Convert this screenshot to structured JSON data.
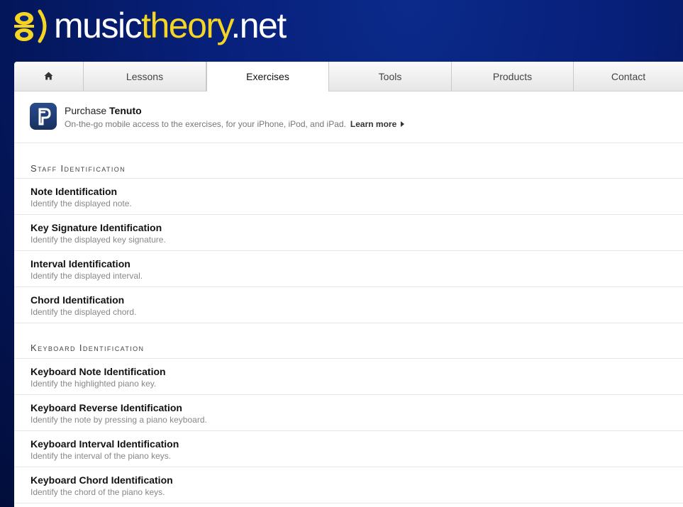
{
  "brand": {
    "part1": "music",
    "part2": "theory",
    "dot": ".",
    "tld": "net"
  },
  "tabs": [
    {
      "label": "",
      "icon": "home-icon"
    },
    {
      "label": "Lessons"
    },
    {
      "label": "Exercises",
      "active": true
    },
    {
      "label": "Tools"
    },
    {
      "label": "Products"
    },
    {
      "label": "Contact"
    }
  ],
  "promo": {
    "prefix": "Purchase",
    "name": "Tenuto",
    "description": "On-the-go mobile access to the exercises, for your iPhone, iPod, and iPad.",
    "link": "Learn more"
  },
  "sections": [
    {
      "heading": "Staff Identification",
      "items": [
        {
          "title": "Note Identification",
          "desc": "Identify the displayed note."
        },
        {
          "title": "Key Signature Identification",
          "desc": "Identify the displayed key signature."
        },
        {
          "title": "Interval Identification",
          "desc": "Identify the displayed interval."
        },
        {
          "title": "Chord Identification",
          "desc": "Identify the displayed chord."
        }
      ]
    },
    {
      "heading": "Keyboard Identification",
      "items": [
        {
          "title": "Keyboard Note Identification",
          "desc": "Identify the highlighted piano key."
        },
        {
          "title": "Keyboard Reverse Identification",
          "desc": "Identify the note by pressing a piano keyboard."
        },
        {
          "title": "Keyboard Interval Identification",
          "desc": "Identify the interval of the piano keys."
        },
        {
          "title": "Keyboard Chord Identification",
          "desc": "Identify the chord of the piano keys."
        }
      ]
    }
  ],
  "colors": {
    "brand_yellow": "#f5d524",
    "header_blue": "#07207a"
  }
}
